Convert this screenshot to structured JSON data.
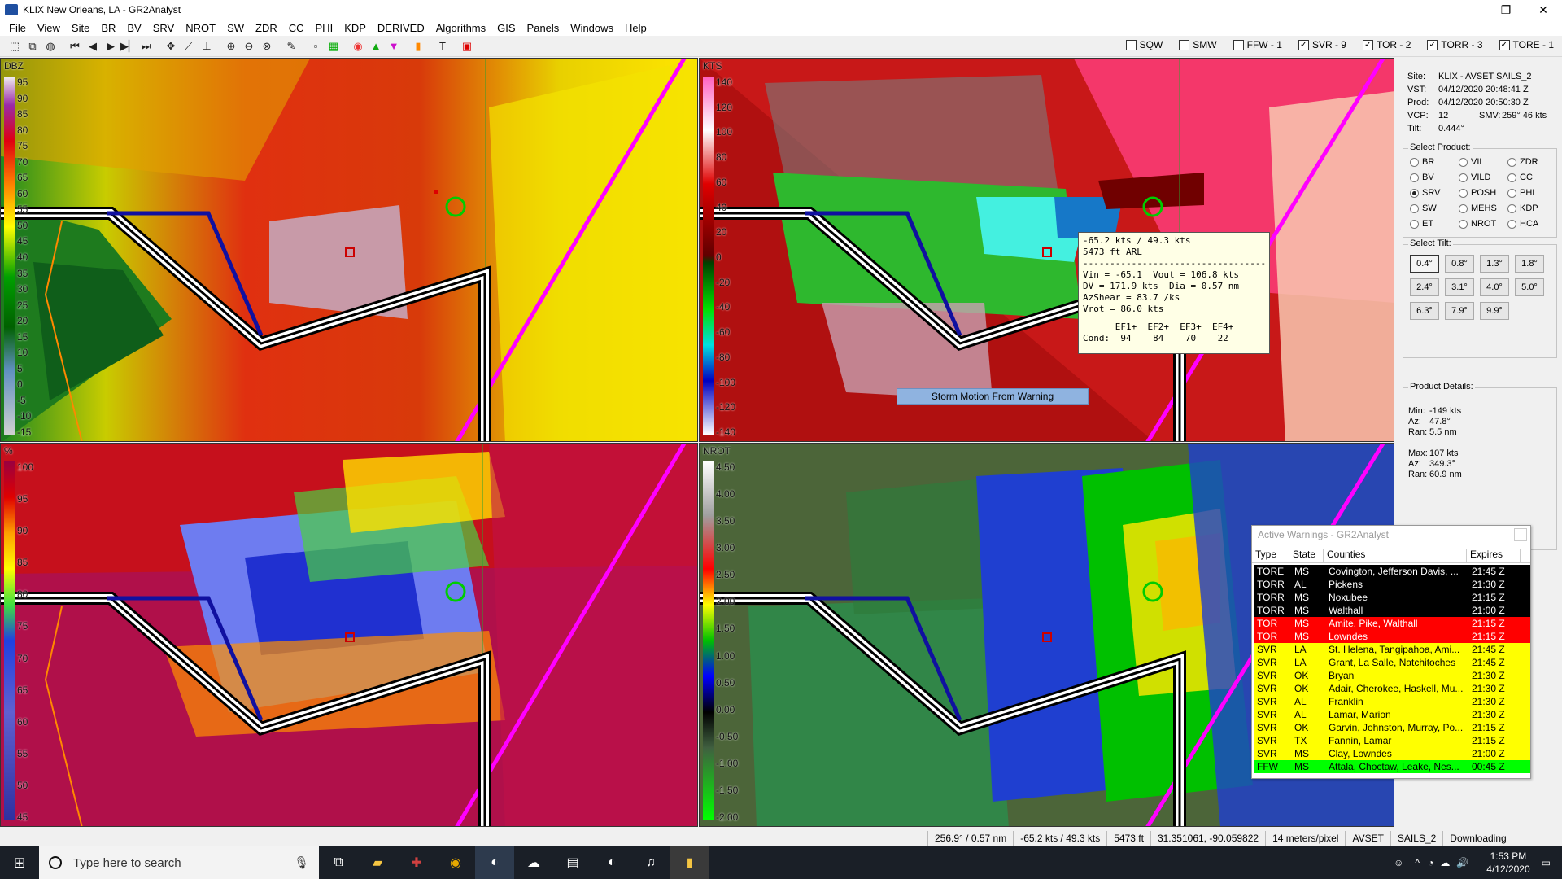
{
  "window": {
    "title": "KLIX New Orleans, LA - GR2Analyst",
    "minimize": "—",
    "maximize": "❐",
    "close": "✕"
  },
  "menu": [
    "File",
    "View",
    "Site",
    "BR",
    "BV",
    "SRV",
    "NROT",
    "SW",
    "ZDR",
    "CC",
    "PHI",
    "KDP",
    "DERIVED",
    "Algorithms",
    "GIS",
    "Panels",
    "Windows",
    "Help"
  ],
  "filters": [
    {
      "label": "SQW",
      "checked": false
    },
    {
      "label": "SMW",
      "checked": false
    },
    {
      "label": "FFW - 1",
      "checked": false
    },
    {
      "label": "SVR - 9",
      "checked": true
    },
    {
      "label": "TOR - 2",
      "checked": true
    },
    {
      "label": "TORR - 3",
      "checked": true
    },
    {
      "label": "TORE - 1",
      "checked": true
    }
  ],
  "panels": {
    "reflectivity": {
      "unit": "DBZ",
      "scale": [
        "95",
        "90",
        "85",
        "80",
        "75",
        "70",
        "65",
        "60",
        "55",
        "50",
        "45",
        "40",
        "35",
        "30",
        "25",
        "20",
        "15",
        "10",
        "5",
        "0",
        "-5",
        "-10",
        "-15"
      ]
    },
    "velocity": {
      "unit": "KTS",
      "scale": [
        "140",
        "120",
        "100",
        "80",
        "60",
        "40",
        "20",
        "0",
        "-20",
        "-40",
        "-60",
        "-80",
        "-100",
        "-120",
        "-140"
      ]
    },
    "correlation": {
      "unit": "%",
      "scale": [
        "100",
        "95",
        "90",
        "85",
        "80",
        "75",
        "70",
        "65",
        "60",
        "55",
        "50",
        "45"
      ]
    },
    "nrot": {
      "unit": "NROT",
      "scale": [
        "4.50",
        "4.00",
        "3.50",
        "3.00",
        "2.50",
        "2.00",
        "1.50",
        "1.00",
        "0.50",
        "0.00",
        "-0.50",
        "-1.00",
        "-1.50",
        "-2.00"
      ]
    }
  },
  "readout": {
    "line1": "-65.2 kts / 49.3 kts",
    "line2": "5473 ft ARL",
    "line3": "----------------------------------",
    "line4": "Vin = -65.1  Vout = 106.8 kts",
    "line5": "DV = 171.9 kts  Dia = 0.57 nm",
    "line6": "AzShear = 83.7 /ks",
    "line7": "Vrot = 86.0 kts",
    "ef_header": "      EF1+  EF2+  EF3+  EF4+",
    "ef_values": "Cond:  94    84    70    22"
  },
  "storm_motion": "Storm Motion From Warning",
  "sidebar": {
    "site_label": "Site:",
    "site": "KLIX - AVSET SAILS_2",
    "vst_label": "VST:",
    "vst": "04/12/2020  20:48:41 Z",
    "prod_label": "Prod:",
    "prod": "04/12/2020  20:50:30 Z",
    "vcp_label": "VCP:",
    "vcp": "12",
    "smv_label": "SMV:",
    "smv": "259° 46 kts",
    "tilt_label": "Tilt:",
    "tilt": "0.444°",
    "select_product": "Select Product:",
    "products": [
      {
        "label": "BR",
        "on": false
      },
      {
        "label": "VIL",
        "on": false
      },
      {
        "label": "ZDR",
        "on": false
      },
      {
        "label": "BV",
        "on": false
      },
      {
        "label": "VILD",
        "on": false
      },
      {
        "label": "CC",
        "on": false
      },
      {
        "label": "SRV",
        "on": true
      },
      {
        "label": "POSH",
        "on": false
      },
      {
        "label": "PHI",
        "on": false
      },
      {
        "label": "SW",
        "on": false
      },
      {
        "label": "MEHS",
        "on": false
      },
      {
        "label": "KDP",
        "on": false
      },
      {
        "label": "ET",
        "on": false
      },
      {
        "label": "NROT",
        "on": false
      },
      {
        "label": "HCA",
        "on": false
      }
    ],
    "select_tilt": "Select Tilt:",
    "tilts": [
      "0.4°",
      "0.8°",
      "1.3°",
      "1.8°",
      "2.4°",
      "3.1°",
      "4.0°",
      "5.0°",
      "6.3°",
      "7.9°",
      "9.9°"
    ],
    "product_details": "Product Details:",
    "min_label": "Min:",
    "min": "-149 kts",
    "min_az_label": "Az:",
    "min_az": "47.8°",
    "min_ran_label": "Ran:",
    "min_ran": "5.5 nm",
    "max_label": "Max:",
    "max": "107 kts",
    "max_az_label": "Az:",
    "max_az": "349.3°",
    "max_ran_label": "Ran:",
    "max_ran": "60.9 nm"
  },
  "warnings": {
    "title": "Active Warnings - GR2Analyst",
    "headers": [
      "Type",
      "State",
      "Counties",
      "Expires"
    ],
    "rows": [
      {
        "type": "TORE",
        "state": "MS",
        "counties": "Covington, Jefferson Davis, ...",
        "expires": "21:45 Z",
        "bg": "#000000",
        "fg": "#ffffff"
      },
      {
        "type": "TORR",
        "state": "AL",
        "counties": "Pickens",
        "expires": "21:30 Z",
        "bg": "#000000",
        "fg": "#ffffff"
      },
      {
        "type": "TORR",
        "state": "MS",
        "counties": "Noxubee",
        "expires": "21:15 Z",
        "bg": "#000000",
        "fg": "#ffffff"
      },
      {
        "type": "TORR",
        "state": "MS",
        "counties": "Walthall",
        "expires": "21:00 Z",
        "bg": "#000000",
        "fg": "#ffffff"
      },
      {
        "type": "TOR",
        "state": "MS",
        "counties": "Amite, Pike, Walthall",
        "expires": "21:15 Z",
        "bg": "#ff0000",
        "fg": "#ffffff"
      },
      {
        "type": "TOR",
        "state": "MS",
        "counties": "Lowndes",
        "expires": "21:15 Z",
        "bg": "#ff0000",
        "fg": "#ffffff"
      },
      {
        "type": "SVR",
        "state": "LA",
        "counties": "St. Helena, Tangipahoa, Ami...",
        "expires": "21:45 Z",
        "bg": "#ffff00",
        "fg": "#000000"
      },
      {
        "type": "SVR",
        "state": "LA",
        "counties": "Grant, La Salle, Natchitoches",
        "expires": "21:45 Z",
        "bg": "#ffff00",
        "fg": "#000000"
      },
      {
        "type": "SVR",
        "state": "OK",
        "counties": "Bryan",
        "expires": "21:30 Z",
        "bg": "#ffff00",
        "fg": "#000000"
      },
      {
        "type": "SVR",
        "state": "OK",
        "counties": "Adair, Cherokee, Haskell, Mu...",
        "expires": "21:30 Z",
        "bg": "#ffff00",
        "fg": "#000000"
      },
      {
        "type": "SVR",
        "state": "AL",
        "counties": "Franklin",
        "expires": "21:30 Z",
        "bg": "#ffff00",
        "fg": "#000000"
      },
      {
        "type": "SVR",
        "state": "AL",
        "counties": "Lamar, Marion",
        "expires": "21:30 Z",
        "bg": "#ffff00",
        "fg": "#000000"
      },
      {
        "type": "SVR",
        "state": "OK",
        "counties": "Garvin, Johnston, Murray, Po...",
        "expires": "21:15 Z",
        "bg": "#ffff00",
        "fg": "#000000"
      },
      {
        "type": "SVR",
        "state": "TX",
        "counties": "Fannin, Lamar",
        "expires": "21:15 Z",
        "bg": "#ffff00",
        "fg": "#000000"
      },
      {
        "type": "SVR",
        "state": "MS",
        "counties": "Clay, Lowndes",
        "expires": "21:00 Z",
        "bg": "#ffff00",
        "fg": "#000000"
      },
      {
        "type": "FFW",
        "state": "MS",
        "counties": "Attala, Choctaw, Leake, Nes...",
        "expires": "00:45 Z",
        "bg": "#00ff00",
        "fg": "#000000"
      }
    ]
  },
  "status": {
    "az_range": "256.9° / 0.57 nm",
    "velocity": "-65.2 kts / 49.3 kts",
    "height": "5473 ft",
    "latlon": "31.351061, -90.059822",
    "resolution": "14 meters/pixel",
    "site": "AVSET",
    "mode": "SAILS_2",
    "state": "Downloading"
  },
  "taskbar": {
    "search_placeholder": "Type here to search",
    "time": "1:53 PM",
    "date": "4/12/2020"
  }
}
